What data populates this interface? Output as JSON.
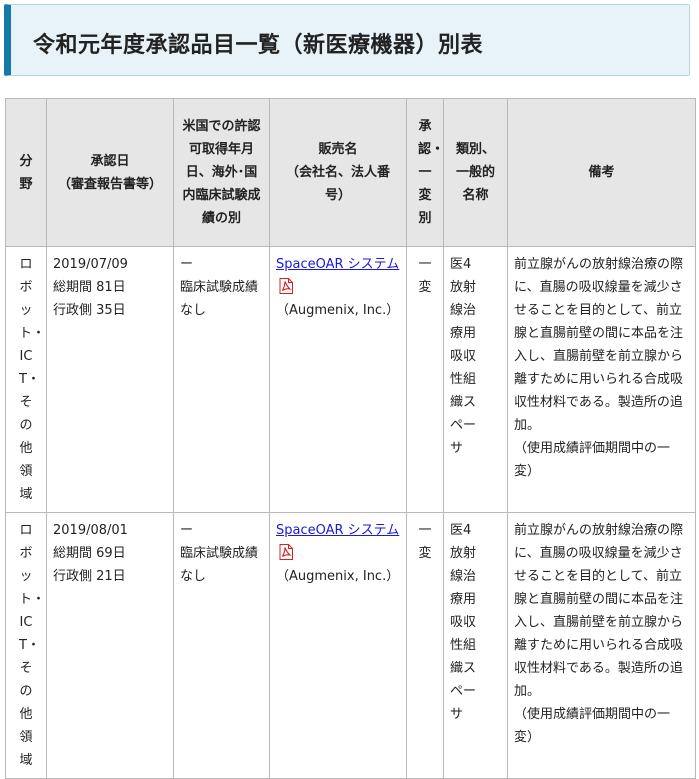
{
  "title": "令和元年度承認品目一覧（新医療機器）別表",
  "table": {
    "headers": {
      "field": "分野",
      "approval_date": "承認日",
      "approval_date_sub": "（審査報告書等）",
      "us_approval": "米国での許認可取得年月日、海外･国内臨床試験成績の別",
      "seller": "販売名",
      "seller_sub": "（会社名、法人番号）",
      "approval_type": "承認・一変別",
      "category": "類別、一般的名称",
      "remarks": "備考"
    },
    "rows": [
      {
        "field": "ロボット・ICT・その他領域",
        "date": "2019/07/09",
        "total_period": "総期間 81日",
        "admin_period": "行政側 35日",
        "us_dash": "ー",
        "us_text": "臨床試験成績なし",
        "product_name": "SpaceOAR システム",
        "company": "（Augmenix, Inc.）",
        "approval_type": "一変",
        "category": "医4放射線治療用吸収性組織スペーサ",
        "remarks": "前立腺がんの放射線治療の際に、直腸の吸収線量を減少させることを目的として、前立腺と直腸前壁の間に本品を注入し、直腸前壁を前立腺から離すために用いられる合成吸収性材料である。製造所の追加。",
        "remarks_note": "（使用成績評価期間中の一変）"
      },
      {
        "field": "ロボット・ICT・その他領域",
        "date": "2019/08/01",
        "total_period": "総期間 69日",
        "admin_period": "行政側 21日",
        "us_dash": "ー",
        "us_text": "臨床試験成績なし",
        "product_name": "SpaceOAR システム",
        "company": "（Augmenix, Inc.）",
        "approval_type": "一変",
        "category": "医4放射線治療用吸収性組織スペーサ",
        "remarks": "前立腺がんの放射線治療の際に、直腸の吸収線量を減少させることを目的として、前立腺と直腸前壁の間に本品を注入し、直腸前壁を前立腺から離すために用いられる合成吸収性材料である。製造所の追加。",
        "remarks_note": "（使用成績評価期間中の一変）"
      }
    ]
  },
  "icons": {
    "pdf": "pdf-icon"
  },
  "colors": {
    "accent": "#147ba8",
    "title_bg": "#e8f3f9",
    "header_bg": "#e6e6e6",
    "link": "#1a1ad8",
    "pdf_red": "#d32020"
  }
}
